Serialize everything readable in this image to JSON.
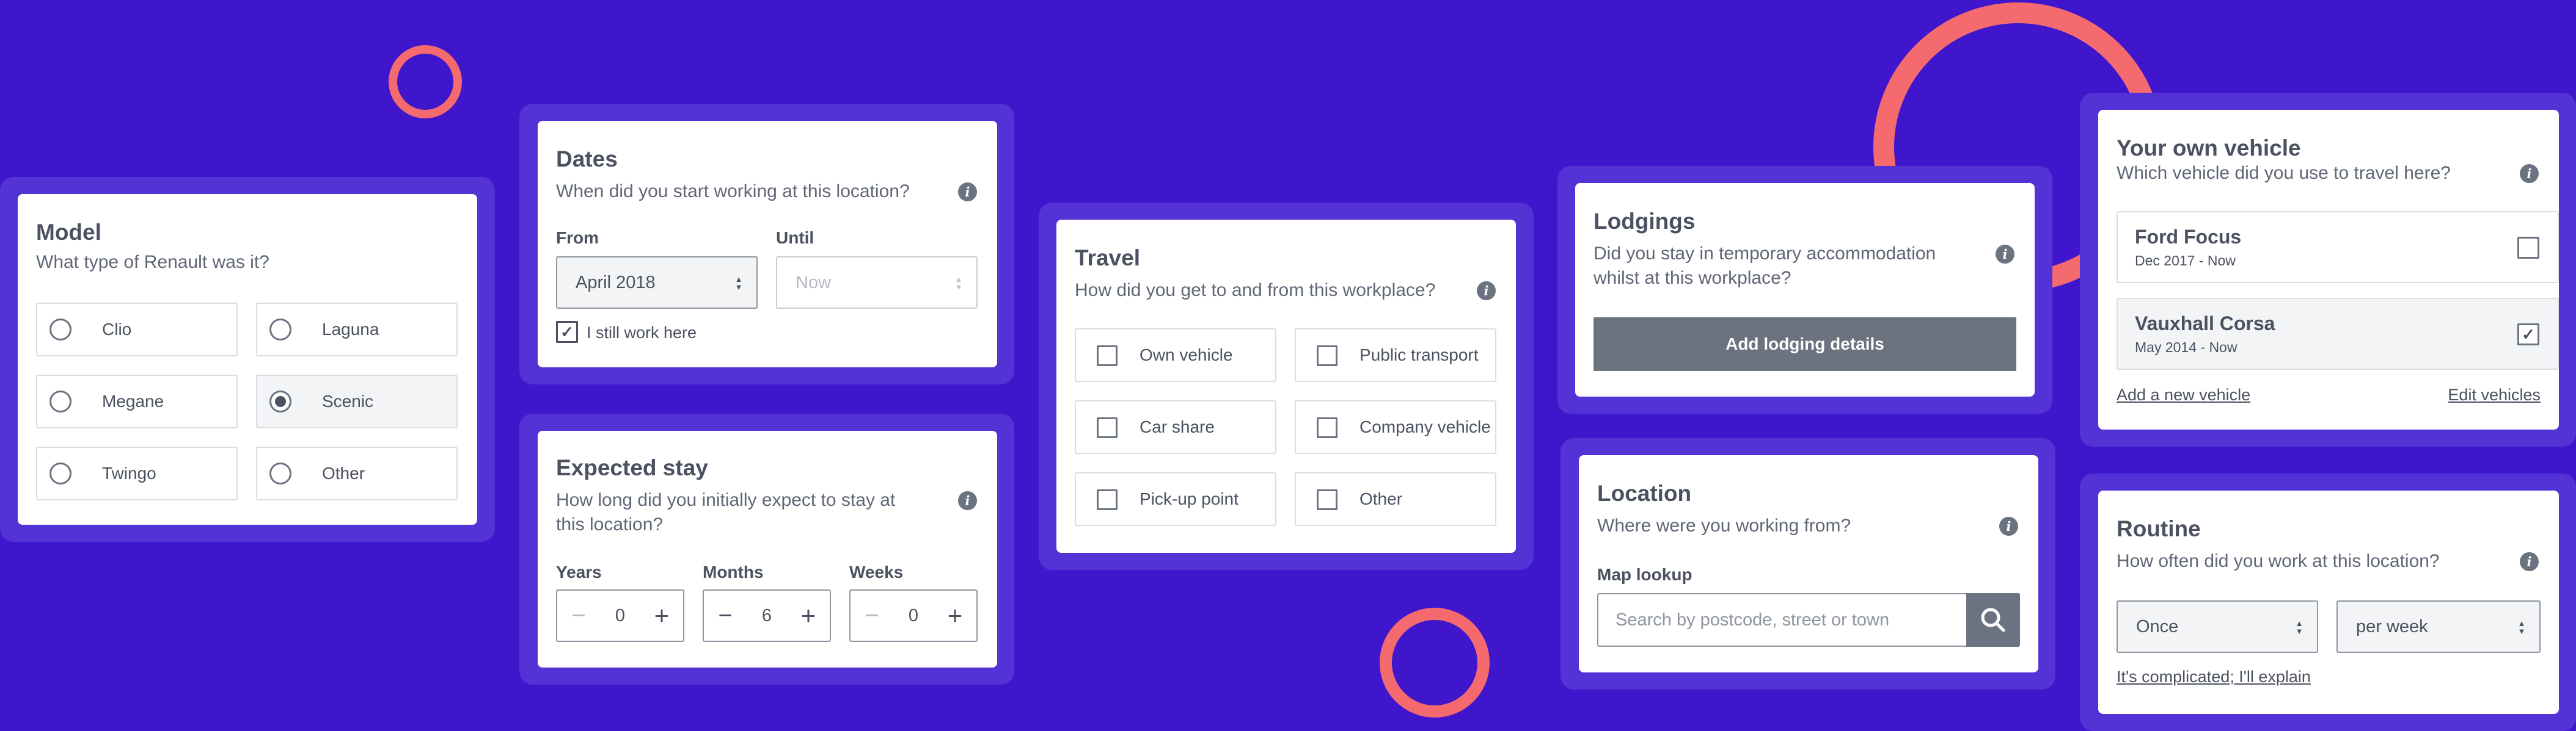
{
  "colors": {
    "background": "#3f16cc",
    "frame": "#5433d6",
    "accent_ring": "#f46a6e",
    "button": "#6b7280"
  },
  "model": {
    "title": "Model",
    "question": "What type of Renault was it?",
    "options": [
      {
        "label": "Clio",
        "selected": false
      },
      {
        "label": "Laguna",
        "selected": false
      },
      {
        "label": "Megane",
        "selected": false
      },
      {
        "label": "Scenic",
        "selected": true
      },
      {
        "label": "Twingo",
        "selected": false
      },
      {
        "label": "Other",
        "selected": false
      }
    ]
  },
  "dates": {
    "title": "Dates",
    "question": "When did you start working at this location?",
    "from_label": "From",
    "from_value": "April 2018",
    "until_label": "Until",
    "until_value": "Now",
    "still_work_label": "I still work here",
    "still_work_checked": true
  },
  "expected_stay": {
    "title": "Expected stay",
    "question_line1": "How long did you initially expect to stay at",
    "question_line2": "this location?",
    "years_label": "Years",
    "years_value": "0",
    "months_label": "Months",
    "months_value": "6",
    "weeks_label": "Weeks",
    "weeks_value": "0",
    "minus": "−",
    "plus": "+"
  },
  "travel": {
    "title": "Travel",
    "question": "How did you get to and from this workplace?",
    "options": [
      {
        "label": "Own vehicle",
        "checked": false
      },
      {
        "label": "Public transport",
        "checked": false
      },
      {
        "label": "Car share",
        "checked": false
      },
      {
        "label": "Company vehicle",
        "checked": false
      },
      {
        "label": "Pick-up point",
        "checked": false
      },
      {
        "label": "Other",
        "checked": false
      }
    ]
  },
  "lodgings": {
    "title": "Lodgings",
    "question_line1": "Did you stay in temporary accommodation",
    "question_line2": "whilst at this workplace?",
    "button": "Add lodging details"
  },
  "location": {
    "title": "Location",
    "question": "Where were you working from?",
    "field_label": "Map lookup",
    "placeholder": "Search by postcode, street or town"
  },
  "vehicle": {
    "title": "Your own vehicle",
    "question": "Which vehicle did you use to travel here?",
    "items": [
      {
        "name": "Ford Focus",
        "dates": "Dec 2017 - Now",
        "checked": false
      },
      {
        "name": "Vauxhall Corsa",
        "dates": "May 2014 - Now",
        "checked": true
      }
    ],
    "add_link": "Add a new vehicle",
    "edit_link": "Edit vehicles"
  },
  "routine": {
    "title": "Routine",
    "question": "How often did you work at this location?",
    "frequency_value": "Once",
    "period_value": "per week",
    "link": "It's complicated; I'll explain"
  },
  "icons": {
    "info": "info-icon",
    "search": "search-icon",
    "check": "✓",
    "select_arrows": "▲▼"
  }
}
